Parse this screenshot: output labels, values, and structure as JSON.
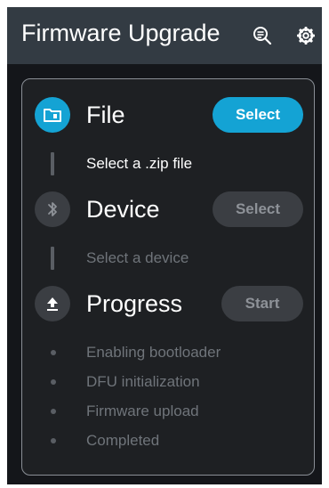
{
  "header": {
    "title": "Firmware Upgrade",
    "search_icon": "search-list-icon",
    "settings_icon": "gear-icon"
  },
  "steps": {
    "file": {
      "label": "File",
      "icon": "folder-icon",
      "button": "Select",
      "hint": "Select a .zip file",
      "state": "active"
    },
    "device": {
      "label": "Device",
      "icon": "bluetooth-icon",
      "button": "Select",
      "hint": "Select a device",
      "state": "disabled"
    },
    "progress": {
      "label": "Progress",
      "icon": "upload-icon",
      "button": "Start",
      "state": "disabled",
      "substeps": [
        "Enabling bootloader",
        "DFU initialization",
        "Firmware upload",
        "Completed"
      ]
    }
  },
  "colors": {
    "accent": "#14a3d4",
    "topbar": "#333b43",
    "background": "#14161a",
    "card": "#1e2023",
    "disabled_text": "#6f747a"
  }
}
